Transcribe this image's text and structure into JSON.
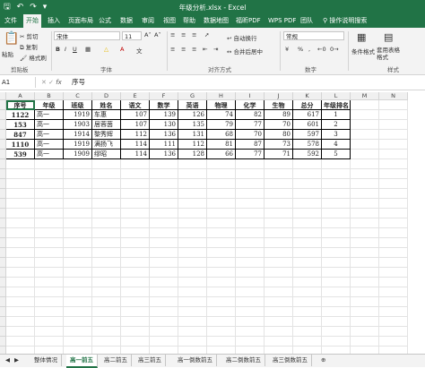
{
  "window": {
    "title": "年级分析.xlsx  -  Excel"
  },
  "ribbon_tabs": [
    "文件",
    "开始",
    "插入",
    "页面布局",
    "公式",
    "数据",
    "审阅",
    "视图",
    "帮助",
    "数据地图",
    "福昕PDF",
    "WPS PDF",
    "团队"
  ],
  "active_tab_index": 1,
  "search": {
    "label": "操作说明搜索"
  },
  "clipboard": {
    "cut": "剪切",
    "copy": "复制",
    "paste": "粘贴",
    "format_painter": "格式刷",
    "group": "剪贴板"
  },
  "font": {
    "name": "宋体",
    "size": "11",
    "group": "字体"
  },
  "alignment": {
    "wrap": "自动换行",
    "merge": "合并后居中",
    "group": "对齐方式"
  },
  "number": {
    "format": "常规",
    "group": "数字"
  },
  "styles": {
    "conditional": "条件格式",
    "table": "套用表格格式",
    "group": "样式"
  },
  "formula_bar": {
    "name_box": "A1",
    "fx": "fx",
    "content": "序号"
  },
  "columns": [
    "A",
    "B",
    "C",
    "D",
    "E",
    "F",
    "G",
    "H",
    "I",
    "J",
    "K",
    "L",
    "M",
    "N"
  ],
  "table": {
    "headers": [
      "序号",
      "年级",
      "班级",
      "姓名",
      "语文",
      "数学",
      "英语",
      "物理",
      "化学",
      "生物",
      "总分",
      "年级排名"
    ],
    "rows": [
      [
        "1122",
        "高一",
        "1919",
        "车惠",
        "107",
        "139",
        "126",
        "74",
        "82",
        "89",
        "617",
        "1"
      ],
      [
        "153",
        "高一",
        "1903",
        "居蓉茵",
        "107",
        "130",
        "135",
        "79",
        "77",
        "70",
        "601",
        "2"
      ],
      [
        "847",
        "高一",
        "1914",
        "黎秀辉",
        "112",
        "136",
        "131",
        "68",
        "70",
        "80",
        "597",
        "3"
      ],
      [
        "1110",
        "高一",
        "1919",
        "满扬飞",
        "114",
        "111",
        "112",
        "81",
        "87",
        "73",
        "578",
        "4"
      ],
      [
        "539",
        "高一",
        "1909",
        "缪昭",
        "114",
        "136",
        "128",
        "66",
        "77",
        "71",
        "592",
        "5"
      ]
    ]
  },
  "sheet_tabs": [
    "整体情况",
    "高一前五",
    "高二前五",
    "高三前五",
    "高一倒数前五",
    "高二倒数前五",
    "高三倒数前五"
  ],
  "active_sheet_index": 1,
  "colors": {
    "accent": "#217346"
  }
}
